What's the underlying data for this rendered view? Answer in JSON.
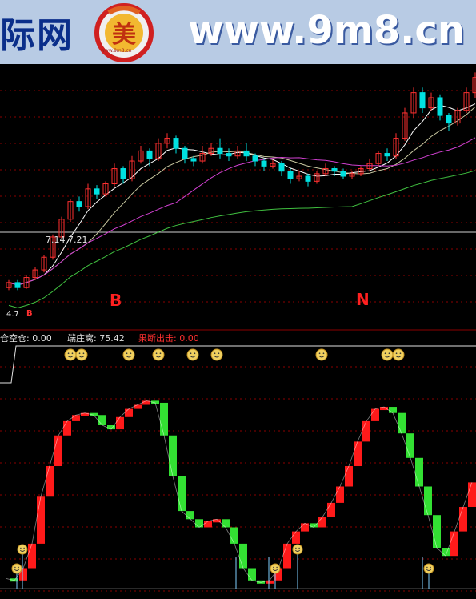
{
  "banner": {
    "site_cn": "际网",
    "site_url": "www.9m8.cn",
    "logo_glyph": "美",
    "logo_subtext": "www.9m8.cn"
  },
  "price_chart": {
    "ma_label": "7.14  7.21",
    "low_label": "4.7",
    "buy_marker": "B",
    "signal_1": "B",
    "signal_2": "N"
  },
  "indicator_header": {
    "item1_label": "仓空仓:",
    "item1_value": "0.00",
    "item2_label": "端庄窝:",
    "item2_value": "75.42",
    "item3_label": "果断出击:",
    "item3_value": "0.00"
  },
  "colors": {
    "up": "#ff3030",
    "down": "#00e0e0",
    "ind_up": "#ff1a1a",
    "ind_down": "#33e033",
    "ma_white": "#ffffff",
    "ma_magenta": "#d040d0",
    "ma_green": "#40c040",
    "grid": "#8b0000"
  },
  "chart_data": {
    "type": "candlestick",
    "candles": [
      [
        4.9,
        5.1,
        4.8,
        5.2
      ],
      [
        5.1,
        4.9,
        4.8,
        5.2
      ],
      [
        4.9,
        5.3,
        4.85,
        5.4
      ],
      [
        5.3,
        5.6,
        5.2,
        5.7
      ],
      [
        5.6,
        6.1,
        5.5,
        6.2
      ],
      [
        6.1,
        6.9,
        6.0,
        7.0
      ],
      [
        6.9,
        7.6,
        6.8,
        7.7
      ],
      [
        7.6,
        8.3,
        7.5,
        8.4
      ],
      [
        8.3,
        8.1,
        7.9,
        8.5
      ],
      [
        8.1,
        8.8,
        8.0,
        9.0
      ],
      [
        8.8,
        8.6,
        8.4,
        8.95
      ],
      [
        8.6,
        9.0,
        8.5,
        9.1
      ],
      [
        9.0,
        9.6,
        8.9,
        9.8
      ],
      [
        9.6,
        9.2,
        9.0,
        9.7
      ],
      [
        9.2,
        9.9,
        9.1,
        10.1
      ],
      [
        9.9,
        10.3,
        9.8,
        10.5
      ],
      [
        10.3,
        10.0,
        9.7,
        10.4
      ],
      [
        10.0,
        10.6,
        9.9,
        10.8
      ],
      [
        10.6,
        10.8,
        10.4,
        11.0
      ],
      [
        10.8,
        10.4,
        10.2,
        10.9
      ],
      [
        10.4,
        10.0,
        9.8,
        10.5
      ],
      [
        10.0,
        9.9,
        9.7,
        10.1
      ],
      [
        9.9,
        10.2,
        9.8,
        10.5
      ],
      [
        10.2,
        10.4,
        10.1,
        10.6
      ],
      [
        10.4,
        10.2,
        10.0,
        10.8
      ],
      [
        10.2,
        10.1,
        9.9,
        10.4
      ],
      [
        10.1,
        10.3,
        10.0,
        10.5
      ],
      [
        10.3,
        10.1,
        9.9,
        10.6
      ],
      [
        10.1,
        9.9,
        9.7,
        10.2
      ],
      [
        9.9,
        9.7,
        9.5,
        10.0
      ],
      [
        9.7,
        9.8,
        9.6,
        9.95
      ],
      [
        9.8,
        9.5,
        9.3,
        9.9
      ],
      [
        9.5,
        9.2,
        9.0,
        9.6
      ],
      [
        9.2,
        9.3,
        9.1,
        9.5
      ],
      [
        9.3,
        9.1,
        8.9,
        9.4
      ],
      [
        9.1,
        9.4,
        9.0,
        9.5
      ],
      [
        9.4,
        9.6,
        9.3,
        9.8
      ],
      [
        9.6,
        9.5,
        9.3,
        9.7
      ],
      [
        9.5,
        9.3,
        9.2,
        9.6
      ],
      [
        9.3,
        9.4,
        9.2,
        9.5
      ],
      [
        9.4,
        9.6,
        9.3,
        9.7
      ],
      [
        9.6,
        9.8,
        9.5,
        10.0
      ],
      [
        9.8,
        10.2,
        9.7,
        10.3
      ],
      [
        10.2,
        10.1,
        9.9,
        10.4
      ],
      [
        10.1,
        10.8,
        10.0,
        11.0
      ],
      [
        10.8,
        11.8,
        10.7,
        12.0
      ],
      [
        11.8,
        12.6,
        11.6,
        12.8
      ],
      [
        12.6,
        12.0,
        11.8,
        12.8
      ],
      [
        12.0,
        12.4,
        11.9,
        12.6
      ],
      [
        12.4,
        11.7,
        11.5,
        12.5
      ],
      [
        11.7,
        11.4,
        11.1,
        11.8
      ],
      [
        11.4,
        11.9,
        11.3,
        12.0
      ],
      [
        11.9,
        12.6,
        11.8,
        12.8
      ],
      [
        12.6,
        13.2,
        12.4,
        13.4
      ]
    ],
    "osc_values": [
      5,
      4,
      10,
      22,
      45,
      60,
      75,
      82,
      85,
      86,
      85,
      80,
      78,
      84,
      88,
      90,
      92,
      91,
      75,
      55,
      38,
      34,
      30,
      33,
      34,
      30,
      22,
      10,
      4,
      3,
      4,
      10,
      22,
      28,
      32,
      30,
      35,
      42,
      50,
      60,
      72,
      82,
      88,
      89,
      86,
      76,
      64,
      50,
      36,
      20,
      16,
      28,
      40,
      52
    ],
    "osc_ylim": [
      0,
      100
    ],
    "ylim": [
      3.8,
      13.6
    ]
  }
}
